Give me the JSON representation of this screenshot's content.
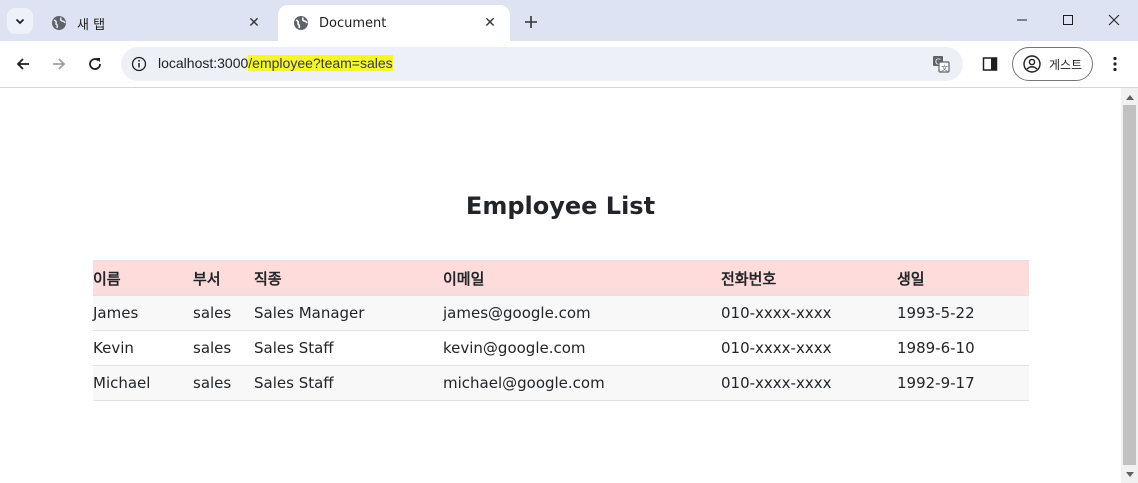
{
  "browser": {
    "tabs": [
      {
        "title": "새 탭",
        "icon": "globe-icon",
        "active": false
      },
      {
        "title": "Document",
        "icon": "globe-icon",
        "active": true
      }
    ],
    "address_bar": {
      "url_host": "localhost:3000",
      "url_path": "/employee?team=sales"
    },
    "profile_label": "게스트"
  },
  "page": {
    "title": "Employee List",
    "table": {
      "columns": [
        "이름",
        "부서",
        "직종",
        "이메일",
        "전화번호",
        "생일"
      ],
      "rows": [
        [
          "James",
          "sales",
          "Sales Manager",
          "james@google.com",
          "010-xxxx-xxxx",
          "1993-5-22"
        ],
        [
          "Kevin",
          "sales",
          "Sales Staff",
          "kevin@google.com",
          "010-xxxx-xxxx",
          "1989-6-10"
        ],
        [
          "Michael",
          "sales",
          "Sales Staff",
          "michael@google.com",
          "010-xxxx-xxxx",
          "1992-9-17"
        ]
      ]
    }
  },
  "colors": {
    "tabstrip_bg": "#dde3f2",
    "url_highlight": "#f5f530",
    "table_header_bg": "#ffdcdc",
    "table_row_stripe": "#f8f8f8"
  }
}
